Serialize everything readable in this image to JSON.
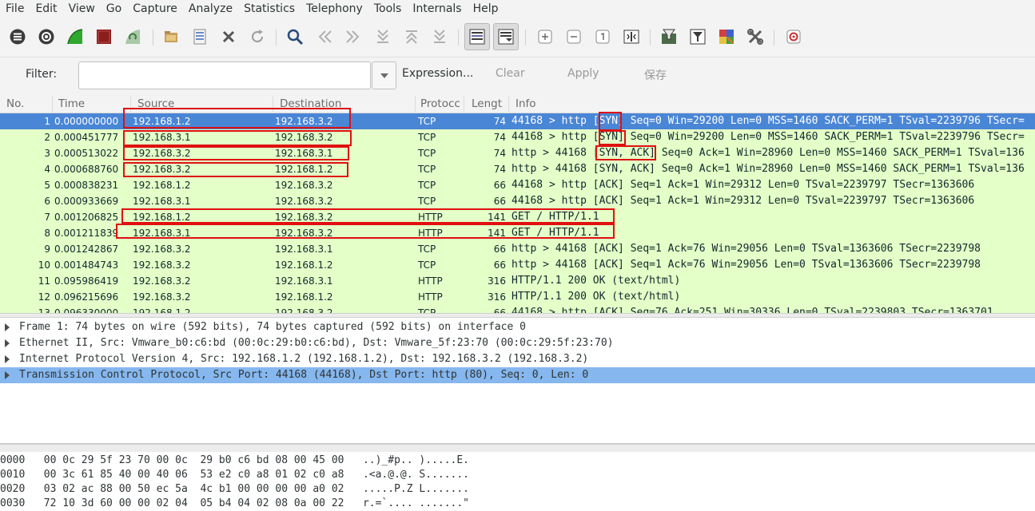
{
  "menu": [
    "File",
    "Edit",
    "View",
    "Go",
    "Capture",
    "Analyze",
    "Statistics",
    "Telephony",
    "Tools",
    "Internals",
    "Help"
  ],
  "filter": {
    "label": "Filter:",
    "value": "",
    "expression": "Expression...",
    "clear": "Clear",
    "apply": "Apply",
    "save": "保存"
  },
  "columns": [
    "No.",
    "Time",
    "Source",
    "Destination",
    "Protocol",
    "Length",
    "Info"
  ],
  "columns_display": [
    "No.",
    "Time",
    "Source",
    "Destination",
    "Protocc",
    "Lengt",
    "Info"
  ],
  "packets": [
    {
      "no": "1",
      "time": "0.000000000",
      "src": "192.168.1.2",
      "dst": "192.168.3.2",
      "proto": "TCP",
      "len": "74",
      "info": "44168 > http [SYN] Seq=0 Win=29200 Len=0 MSS=1460 SACK_PERM=1 TSval=2239796 TSecr=",
      "selected": true
    },
    {
      "no": "2",
      "time": "0.000451777",
      "src": "192.168.3.1",
      "dst": "192.168.3.2",
      "proto": "TCP",
      "len": "74",
      "info": "44168 > http [SYN] Seq=0 Win=29200 Len=0 MSS=1460 SACK_PERM=1 TSval=2239796 TSecr=",
      "selected": false
    },
    {
      "no": "3",
      "time": "0.000513022",
      "src": "192.168.3.2",
      "dst": "192.168.3.1",
      "proto": "TCP",
      "len": "74",
      "info": "http > 44168 [SYN, ACK] Seq=0 Ack=1 Win=28960 Len=0 MSS=1460 SACK_PERM=1 TSval=136",
      "selected": false
    },
    {
      "no": "4",
      "time": "0.000688760",
      "src": "192.168.3.2",
      "dst": "192.168.1.2",
      "proto": "TCP",
      "len": "74",
      "info": "http > 44168 [SYN, ACK] Seq=0 Ack=1 Win=28960 Len=0 MSS=1460 SACK_PERM=1 TSval=136",
      "selected": false
    },
    {
      "no": "5",
      "time": "0.000838231",
      "src": "192.168.1.2",
      "dst": "192.168.3.2",
      "proto": "TCP",
      "len": "66",
      "info": "44168 > http [ACK] Seq=1 Ack=1 Win=29312 Len=0 TSval=2239797 TSecr=1363606",
      "selected": false
    },
    {
      "no": "6",
      "time": "0.000933669",
      "src": "192.168.3.1",
      "dst": "192.168.3.2",
      "proto": "TCP",
      "len": "66",
      "info": "44168 > http [ACK] Seq=1 Ack=1 Win=29312 Len=0 TSval=2239797 TSecr=1363606",
      "selected": false
    },
    {
      "no": "7",
      "time": "0.001206825",
      "src": "192.168.1.2",
      "dst": "192.168.3.2",
      "proto": "HTTP",
      "len": "141",
      "info": "GET / HTTP/1.1",
      "selected": false
    },
    {
      "no": "8",
      "time": "0.001211839",
      "src": "192.168.3.1",
      "dst": "192.168.3.2",
      "proto": "HTTP",
      "len": "141",
      "info": "GET / HTTP/1.1",
      "selected": false
    },
    {
      "no": "9",
      "time": "0.001242867",
      "src": "192.168.3.2",
      "dst": "192.168.3.1",
      "proto": "TCP",
      "len": "66",
      "info": "http > 44168 [ACK] Seq=1 Ack=76 Win=29056 Len=0 TSval=1363606 TSecr=2239798",
      "selected": false
    },
    {
      "no": "10",
      "time": "0.001484743",
      "src": "192.168.3.2",
      "dst": "192.168.1.2",
      "proto": "TCP",
      "len": "66",
      "info": "http > 44168 [ACK] Seq=1 Ack=76 Win=29056 Len=0 TSval=1363606 TSecr=2239798",
      "selected": false
    },
    {
      "no": "11",
      "time": "0.095986419",
      "src": "192.168.3.2",
      "dst": "192.168.3.1",
      "proto": "HTTP",
      "len": "316",
      "info": "HTTP/1.1 200 OK  (text/html)",
      "selected": false
    },
    {
      "no": "12",
      "time": "0.096215696",
      "src": "192.168.3.2",
      "dst": "192.168.1.2",
      "proto": "HTTP",
      "len": "316",
      "info": "HTTP/1.1 200 OK  (text/html)",
      "selected": false
    },
    {
      "no": "13",
      "time": "0.096330000",
      "src": "192.168.1.2",
      "dst": "192.168.3.2",
      "proto": "TCP",
      "len": "66",
      "info": "44168 > http [ACK] Seq=76 Ack=251 Win=30336 Len=0 TSval=2239803 TSecr=1363701",
      "selected": false
    }
  ],
  "details": [
    {
      "text": "Frame 1: 74 bytes on wire (592 bits), 74 bytes captured (592 bits) on interface 0",
      "selected": false
    },
    {
      "text": "Ethernet II, Src: Vmware_b0:c6:bd (00:0c:29:b0:c6:bd), Dst: Vmware_5f:23:70 (00:0c:29:5f:23:70)",
      "selected": false
    },
    {
      "text": "Internet Protocol Version 4, Src: 192.168.1.2 (192.168.1.2), Dst: 192.168.3.2 (192.168.3.2)",
      "selected": false
    },
    {
      "text": "Transmission Control Protocol, Src Port: 44168 (44168), Dst Port: http (80), Seq: 0, Len: 0",
      "selected": true
    }
  ],
  "hex": [
    "0000   00 0c 29 5f 23 70 00 0c  29 b0 c6 bd 08 00 45 00   ..)_#p.. ).....E.",
    "0010   00 3c 61 85 40 00 40 06  53 e2 c0 a8 01 02 c0 a8   .<a.@.@. S.......",
    "0020   03 02 ac 88 00 50 ec 5a  4c b1 00 00 00 00 a0 02   .....P.Z L.......",
    "0030   72 10 3d 60 00 00 02 04  05 b4 04 02 08 0a 00 22   r.=`.... .......\""
  ],
  "colors": {
    "row_bg": "#e4ffc7",
    "selected_row": "#4a86d6",
    "selected_detail": "#86b7ee",
    "highlight_box": "#e01010"
  }
}
